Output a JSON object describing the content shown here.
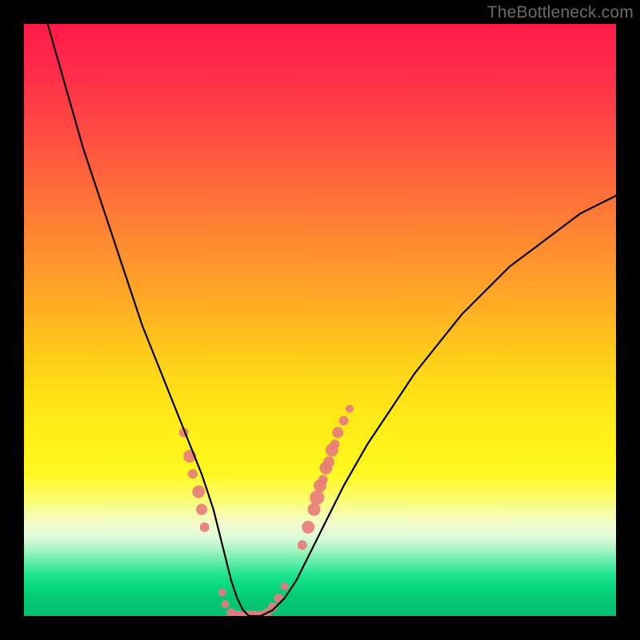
{
  "watermark": "TheBottleneck.com",
  "chart_data": {
    "type": "line",
    "title": "",
    "xlabel": "",
    "ylabel": "",
    "xlim": [
      0,
      100
    ],
    "ylim": [
      0,
      100
    ],
    "series": [
      {
        "name": "bottleneck-curve",
        "x": [
          4,
          6,
          8,
          10,
          12,
          14,
          16,
          18,
          20,
          22,
          24,
          26,
          28,
          30,
          32,
          33,
          34,
          35,
          36,
          37,
          38,
          39,
          40,
          42,
          44,
          46,
          48,
          50,
          52,
          54,
          58,
          62,
          66,
          70,
          74,
          78,
          82,
          86,
          90,
          94,
          98,
          100
        ],
        "y": [
          100,
          93,
          86,
          79,
          73,
          67,
          61,
          55,
          49,
          44,
          39,
          34,
          29,
          24,
          18,
          14,
          10,
          6,
          3,
          1,
          0,
          0,
          0,
          1,
          3,
          6,
          10,
          14,
          18,
          22,
          29,
          35,
          41,
          46,
          51,
          55,
          59,
          62,
          65,
          68,
          70,
          71
        ]
      }
    ],
    "scatter_overlay": {
      "name": "data-points",
      "color": "#e77b7b",
      "points": [
        {
          "x": 27.0,
          "y": 31,
          "r": 6
        },
        {
          "x": 28.0,
          "y": 27,
          "r": 8
        },
        {
          "x": 28.5,
          "y": 24,
          "r": 6
        },
        {
          "x": 29.5,
          "y": 21,
          "r": 8
        },
        {
          "x": 30.0,
          "y": 18,
          "r": 7
        },
        {
          "x": 30.5,
          "y": 15,
          "r": 6
        },
        {
          "x": 33.5,
          "y": 4,
          "r": 5
        },
        {
          "x": 34.0,
          "y": 2,
          "r": 5
        },
        {
          "x": 35.0,
          "y": 0.5,
          "r": 6
        },
        {
          "x": 36.0,
          "y": 0,
          "r": 7
        },
        {
          "x": 37.0,
          "y": 0,
          "r": 7
        },
        {
          "x": 38.0,
          "y": 0,
          "r": 7
        },
        {
          "x": 39.0,
          "y": 0,
          "r": 7
        },
        {
          "x": 40.0,
          "y": 0,
          "r": 7
        },
        {
          "x": 41.0,
          "y": 0.5,
          "r": 6
        },
        {
          "x": 42.0,
          "y": 1.5,
          "r": 6
        },
        {
          "x": 43.0,
          "y": 3,
          "r": 6
        },
        {
          "x": 44.0,
          "y": 5,
          "r": 5
        },
        {
          "x": 47.0,
          "y": 12,
          "r": 6
        },
        {
          "x": 48.0,
          "y": 15,
          "r": 8
        },
        {
          "x": 49.0,
          "y": 18,
          "r": 8
        },
        {
          "x": 49.5,
          "y": 20,
          "r": 9
        },
        {
          "x": 50.0,
          "y": 22,
          "r": 8
        },
        {
          "x": 50.5,
          "y": 23,
          "r": 6
        },
        {
          "x": 51.0,
          "y": 25,
          "r": 8
        },
        {
          "x": 51.5,
          "y": 26,
          "r": 7
        },
        {
          "x": 52.0,
          "y": 28,
          "r": 8
        },
        {
          "x": 52.5,
          "y": 29,
          "r": 6
        },
        {
          "x": 53.0,
          "y": 31,
          "r": 7
        },
        {
          "x": 54.0,
          "y": 33,
          "r": 6
        },
        {
          "x": 55.0,
          "y": 35,
          "r": 5
        }
      ]
    },
    "gradient_stops": [
      {
        "pos": 0,
        "color": "#ff1a4a"
      },
      {
        "pos": 20,
        "color": "#ff5040"
      },
      {
        "pos": 45,
        "color": "#ffa428"
      },
      {
        "pos": 70,
        "color": "#fff018"
      },
      {
        "pos": 85,
        "color": "#eefcd4"
      },
      {
        "pos": 100,
        "color": "#02c070"
      }
    ]
  }
}
